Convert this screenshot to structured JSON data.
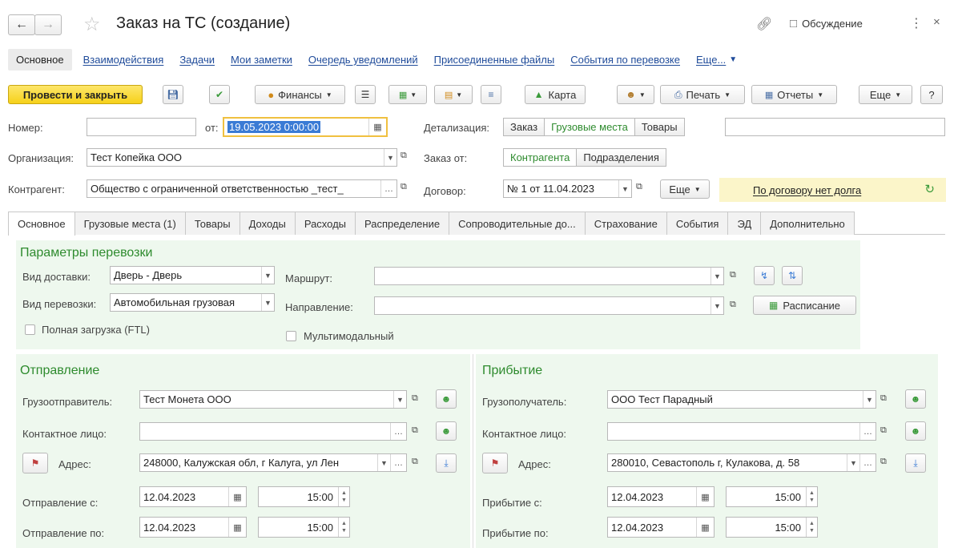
{
  "window": {
    "title": "Заказ на ТС (создание)",
    "discussion": "Обсуждение"
  },
  "nav": {
    "items": [
      "Основное",
      "Взаимодействия",
      "Задачи",
      "Мои заметки",
      "Очередь уведомлений",
      "Присоединенные файлы",
      "События по перевозке",
      "Еще..."
    ]
  },
  "toolbar": {
    "post_close": "Провести и закрыть",
    "finance": "Финансы",
    "map": "Карта",
    "print": "Печать",
    "reports": "Отчеты",
    "more": "Еще",
    "help": "?"
  },
  "header": {
    "number_label": "Номер:",
    "number_value": "",
    "date_label": "от:",
    "date_value": "19.05.2023  0:00:00",
    "detail_label": "Детализация:",
    "detail_options": [
      "Заказ",
      "Грузовые места",
      "Товары"
    ],
    "detail_extra": "",
    "org_label": "Организация:",
    "org_value": "Тест Копейка ООО",
    "order_from_label": "Заказ от:",
    "order_from_options": [
      "Контрагента",
      "Подразделения"
    ],
    "contractor_label": "Контрагент:",
    "contractor_value": "Общество с ограниченной ответственностью _тест_",
    "contract_label": "Договор:",
    "contract_value": "№ 1 от 11.04.2023",
    "contract_more": "Еще",
    "debt_status": "По договору нет долга"
  },
  "tabs": [
    "Основное",
    "Грузовые места (1)",
    "Товары",
    "Доходы",
    "Расходы",
    "Распределение",
    "Сопроводительные до...",
    "Страхование",
    "События",
    "ЭД",
    "Дополнительно"
  ],
  "params": {
    "title": "Параметры перевозки",
    "delivery_label": "Вид доставки:",
    "delivery_value": "Дверь - Дверь",
    "route_label": "Маршрут:",
    "route_value": "",
    "transport_label": "Вид перевозки:",
    "transport_value": "Автомобильная грузовая",
    "direction_label": "Направление:",
    "direction_value": "",
    "schedule": "Расписание",
    "ftl": "Полная загрузка (FTL)",
    "multimodal": "Мультимодальный"
  },
  "departure": {
    "title": "Отправление",
    "shipper_label": "Грузоотправитель:",
    "shipper_value": "Тест Монета ООО",
    "contact_label": "Контактное лицо:",
    "contact_value": "",
    "address_label": "Адрес:",
    "address_value": "248000, Калужская обл, г Калуга, ул Лен",
    "from_label": "Отправление с:",
    "from_date": "12.04.2023",
    "from_time": "15:00",
    "to_label": "Отправление по:",
    "to_date": "12.04.2023",
    "to_time": "15:00"
  },
  "arrival": {
    "title": "Прибытие",
    "consignee_label": "Грузополучатель:",
    "consignee_value": "ООО Тест Парадный",
    "contact_label": "Контактное лицо:",
    "contact_value": "",
    "address_label": "Адрес:",
    "address_value": "280010, Севастополь г, Кулакова, д. 58",
    "from_label": "Прибытие с:",
    "from_date": "12.04.2023",
    "from_time": "15:00",
    "to_label": "Прибытие по:",
    "to_date": "12.04.2023",
    "to_time": "15:00"
  }
}
